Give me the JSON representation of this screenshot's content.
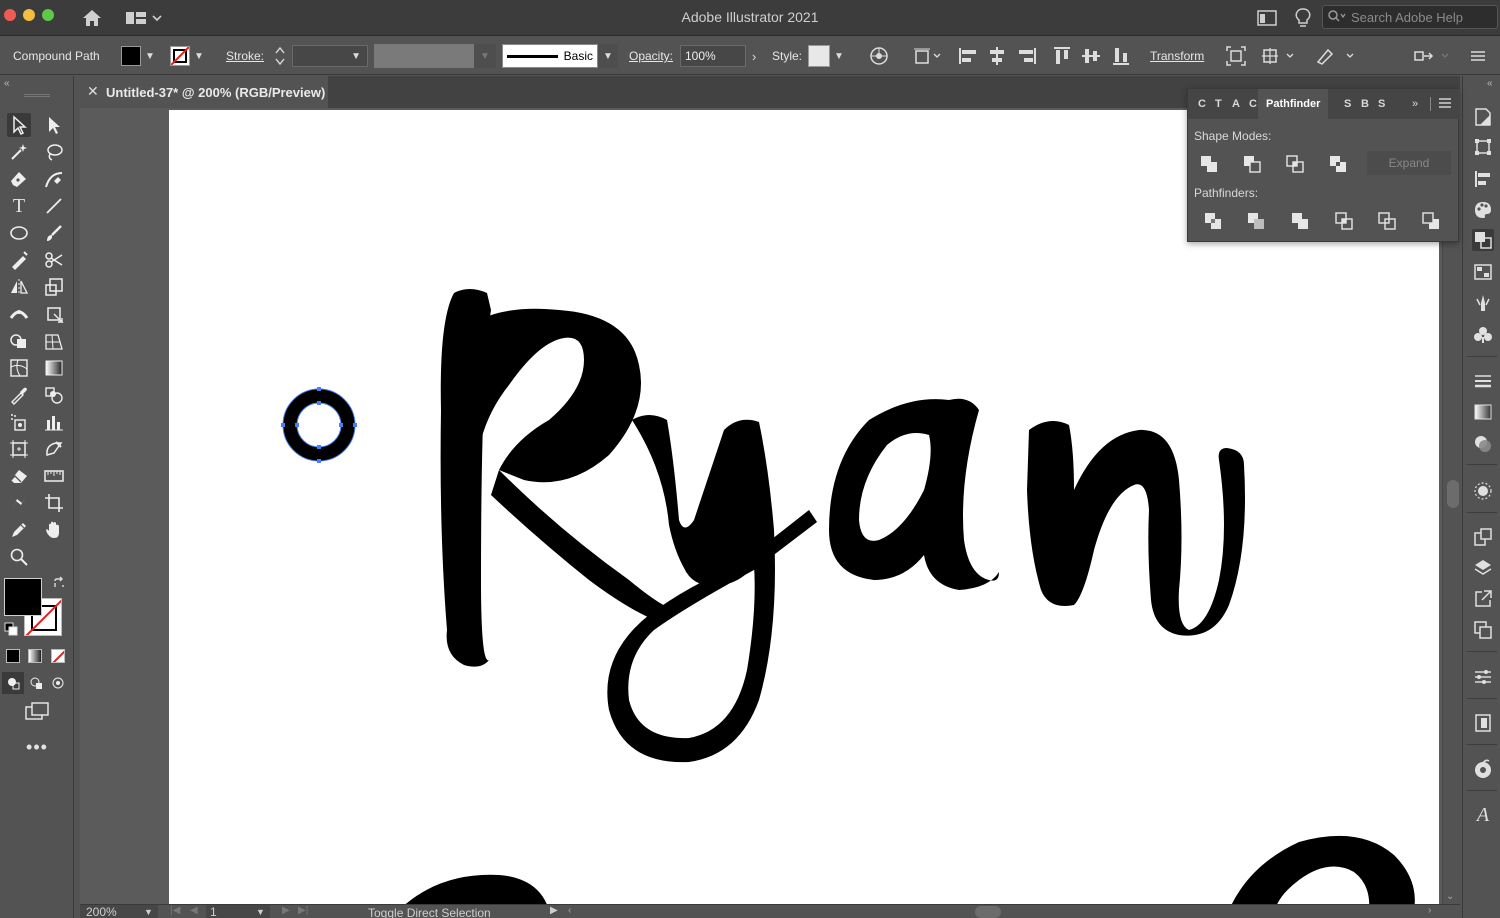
{
  "app": {
    "title": "Adobe Illustrator 2021"
  },
  "search": {
    "placeholder": "Search Adobe Help"
  },
  "control_bar": {
    "selection_type": "Compound Path",
    "stroke_label": "Stroke:",
    "stroke_weight": "",
    "brush_name": "Basic",
    "opacity_label": "Opacity:",
    "opacity_value": "100%",
    "style_label": "Style:",
    "transform_label": "Transform"
  },
  "document_tab": {
    "title": "Untitled-37* @ 200% (RGB/Preview)"
  },
  "pathfinder_panel": {
    "tabs": [
      "C",
      "T",
      "A",
      "C",
      "Pathfinder",
      "S",
      "B",
      "S"
    ],
    "active_tab": "Pathfinder",
    "shape_modes_label": "Shape Modes:",
    "pathfinders_label": "Pathfinders:",
    "expand_label": "Expand",
    "shape_mode_buttons": [
      "unite",
      "minus-front",
      "intersect",
      "exclude"
    ],
    "pathfinder_buttons": [
      "divide",
      "trim",
      "merge",
      "crop",
      "outline",
      "minus-back"
    ]
  },
  "canvas": {
    "artboard_color": "#ffffff",
    "artwork_text": "Ryan",
    "selected_object": "compound-path-ring"
  },
  "status_bar": {
    "zoom": "200%",
    "artboard_number": "1",
    "status_text": "Toggle Direct Selection"
  },
  "colors": {
    "fill": "#000000",
    "stroke": "none",
    "selection_accent": "#4a7ff0",
    "ui_panel": "#535353"
  }
}
